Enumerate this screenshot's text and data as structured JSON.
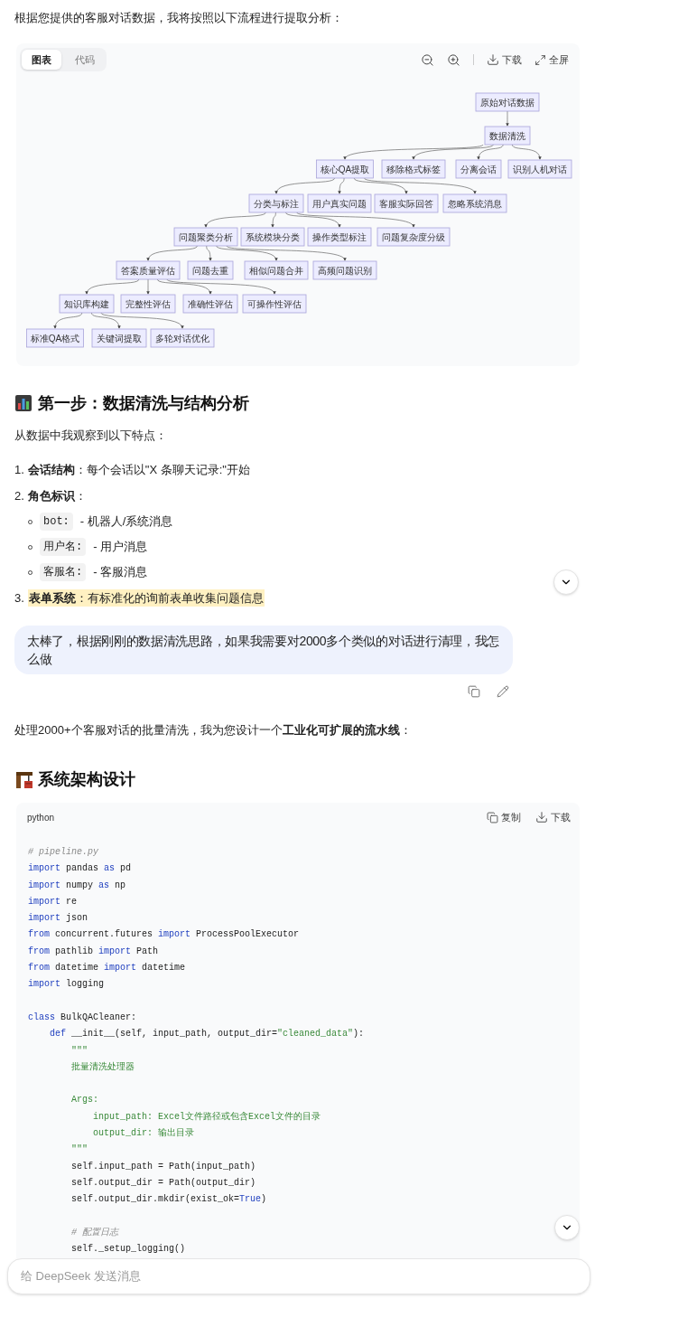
{
  "intro": "根据您提供的客服对话数据，我将按照以下流程进行提取分析：",
  "diagram": {
    "tabs": [
      {
        "label": "图表",
        "selected": true
      },
      {
        "label": "代码",
        "selected": false
      }
    ],
    "actions": [
      {
        "kind": "zoom-out"
      },
      {
        "kind": "zoom-in"
      },
      {
        "kind": "download",
        "label": "下载"
      },
      {
        "kind": "fullscreen",
        "label": "全屏"
      }
    ],
    "root": {
      "label": "原始对话数据",
      "children": [
        {
          "label": "数据清洗",
          "children": [
            {
              "label": "核心QA提取",
              "children": [
                {
                  "label": "分类与标注",
                  "children": [
                    {
                      "label": "问题聚类分析",
                      "children": [
                        {
                          "label": "答案质量评估",
                          "children": [
                            {
                              "label": "知识库构建",
                              "children": [
                                {
                                  "label": "标准QA格式"
                                },
                                {
                                  "label": "关键词提取"
                                },
                                {
                                  "label": "多轮对话优化"
                                }
                              ]
                            },
                            {
                              "label": "完整性评估"
                            },
                            {
                              "label": "准确性评估"
                            },
                            {
                              "label": "可操作性评估"
                            }
                          ]
                        },
                        {
                          "label": "问题去重"
                        },
                        {
                          "label": "相似问题合并"
                        },
                        {
                          "label": "高频问题识别"
                        }
                      ]
                    },
                    {
                      "label": "系统模块分类"
                    },
                    {
                      "label": "操作类型标注"
                    },
                    {
                      "label": "问题复杂度分级"
                    }
                  ]
                },
                {
                  "label": "用户真实问题"
                },
                {
                  "label": "客服实际回答"
                },
                {
                  "label": "忽略系统消息"
                }
              ]
            },
            {
              "label": "移除格式标签"
            },
            {
              "label": "分离会话"
            },
            {
              "label": "识别人机对话"
            }
          ]
        }
      ]
    }
  },
  "heading_1": "第一步：数据清洗与结构分析",
  "observation": "从数据中我观察到以下特点：",
  "features": [
    {
      "marker": "1.",
      "text": "**会话结构**：每个会话以\"X 条聊天记录:\"开始",
      "highlighted": false
    },
    {
      "marker": "2.",
      "text": "**角色标识**：",
      "highlighted": false,
      "bullets": [
        {
          "code": "bot:",
          "text": "- 机器人/系统消息"
        },
        {
          "code": "用户名:",
          "text": "- 用户消息"
        },
        {
          "code": "客服名:",
          "text": "- 客服消息"
        }
      ]
    },
    {
      "marker": "3.",
      "text": "**表单系统**：有标准化的询前表单收集问题信息",
      "highlighted": true
    }
  ],
  "user_message": "太棒了，根据刚刚的数据清洗思路，如果我需要对2000多个类似的对话进行清理，我怎么做",
  "reply_intro": "处理2000+个客服对话的批量清洗，我为您设计一个**工业化可扩展的流水线**：",
  "heading_2": "系统架构设计",
  "code_block": {
    "language": "python",
    "actions": [
      {
        "kind": "copy",
        "label": "复制"
      },
      {
        "kind": "download",
        "label": "下载"
      }
    ],
    "lines": [
      {
        "kind": "code",
        "segs": [
          {
            "kind": "comment",
            "text": "# pipeline.py"
          }
        ]
      },
      {
        "kind": "code",
        "segs": [
          {
            "kind": "kw",
            "text": "import"
          },
          {
            "kind": "plain",
            "text": " pandas "
          },
          {
            "kind": "kw",
            "text": "as"
          },
          {
            "kind": "plain",
            "text": " pd"
          }
        ]
      },
      {
        "kind": "code",
        "segs": [
          {
            "kind": "kw",
            "text": "import"
          },
          {
            "kind": "plain",
            "text": " numpy "
          },
          {
            "kind": "kw",
            "text": "as"
          },
          {
            "kind": "plain",
            "text": " np"
          }
        ]
      },
      {
        "kind": "code",
        "segs": [
          {
            "kind": "kw",
            "text": "import"
          },
          {
            "kind": "plain",
            "text": " re"
          }
        ]
      },
      {
        "kind": "code",
        "segs": [
          {
            "kind": "kw",
            "text": "import"
          },
          {
            "kind": "plain",
            "text": " json"
          }
        ]
      },
      {
        "kind": "code",
        "segs": [
          {
            "kind": "kw",
            "text": "from"
          },
          {
            "kind": "plain",
            "text": " concurrent.futures "
          },
          {
            "kind": "kw",
            "text": "import"
          },
          {
            "kind": "plain",
            "text": " ProcessPoolExecutor"
          }
        ]
      },
      {
        "kind": "code",
        "segs": [
          {
            "kind": "kw",
            "text": "from"
          },
          {
            "kind": "plain",
            "text": " pathlib "
          },
          {
            "kind": "kw",
            "text": "import"
          },
          {
            "kind": "plain",
            "text": " Path"
          }
        ]
      },
      {
        "kind": "code",
        "segs": [
          {
            "kind": "kw",
            "text": "from"
          },
          {
            "kind": "plain",
            "text": " datetime "
          },
          {
            "kind": "kw",
            "text": "import"
          },
          {
            "kind": "plain",
            "text": " datetime"
          }
        ]
      },
      {
        "kind": "code",
        "segs": [
          {
            "kind": "kw",
            "text": "import"
          },
          {
            "kind": "plain",
            "text": " logging"
          }
        ]
      },
      {
        "kind": "blank"
      },
      {
        "kind": "code",
        "segs": [
          {
            "kind": "kw",
            "text": "class"
          },
          {
            "kind": "plain",
            "text": " BulkQACleaner:"
          }
        ]
      },
      {
        "kind": "code",
        "segs": [
          {
            "kind": "kw",
            "text": "    def"
          },
          {
            "kind": "plain",
            "text": " __init__(self, input_path, output_dir="
          },
          {
            "kind": "str",
            "text": "\"cleaned_data\""
          },
          {
            "kind": "plain",
            "text": "):"
          }
        ]
      },
      {
        "kind": "code",
        "segs": [
          {
            "kind": "str",
            "text": "        \"\"\""
          }
        ]
      },
      {
        "kind": "code",
        "segs": [
          {
            "kind": "str",
            "text": "        批量清洗处理器"
          }
        ]
      },
      {
        "kind": "blank"
      },
      {
        "kind": "code",
        "segs": [
          {
            "kind": "str",
            "text": "        Args:"
          }
        ]
      },
      {
        "kind": "code",
        "segs": [
          {
            "kind": "str",
            "text": "            input_path: Excel文件路径或包含Excel文件的目录"
          }
        ]
      },
      {
        "kind": "code",
        "segs": [
          {
            "kind": "str",
            "text": "            output_dir: 输出目录"
          }
        ]
      },
      {
        "kind": "code",
        "segs": [
          {
            "kind": "str",
            "text": "        \"\"\""
          }
        ]
      },
      {
        "kind": "code",
        "segs": [
          {
            "kind": "plain",
            "text": "        self.input_path = Path(input_path)"
          }
        ]
      },
      {
        "kind": "code",
        "segs": [
          {
            "kind": "plain",
            "text": "        self.output_dir = Path(output_dir)"
          }
        ]
      },
      {
        "kind": "code",
        "segs": [
          {
            "kind": "plain",
            "text": "        self.output_dir.mkdir(exist_ok="
          },
          {
            "kind": "kw",
            "text": "True"
          },
          {
            "kind": "plain",
            "text": ")"
          }
        ]
      },
      {
        "kind": "blank"
      },
      {
        "kind": "code",
        "segs": [
          {
            "kind": "comment",
            "text": "        # 配置日志"
          }
        ]
      },
      {
        "kind": "code",
        "segs": [
          {
            "kind": "plain",
            "text": "        self._setup_logging()"
          }
        ]
      }
    ]
  },
  "input": {
    "placeholder": "给 DeepSeek 发送消息"
  }
}
